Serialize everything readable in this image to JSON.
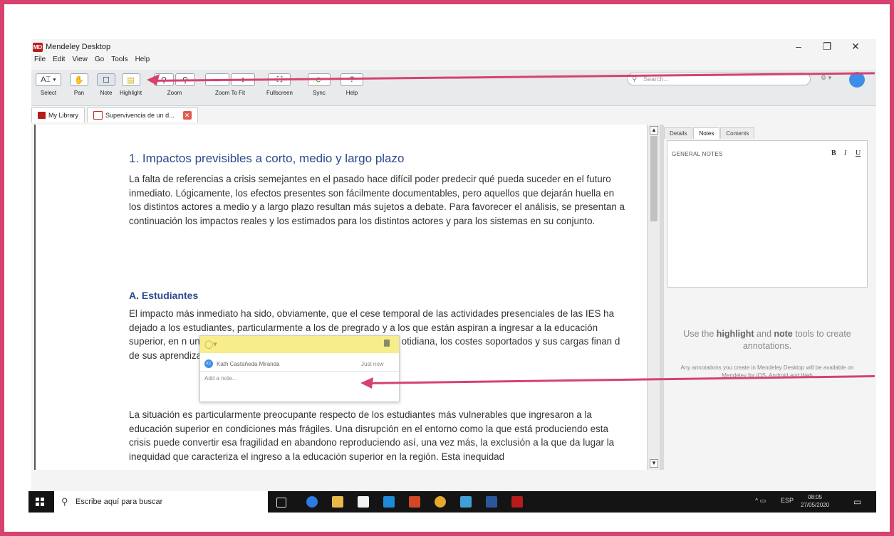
{
  "window": {
    "title": "Mendeley Desktop",
    "logo": "MD",
    "minimize": "–",
    "maximize": "❐",
    "close": "✕"
  },
  "menu": [
    "File",
    "Edit",
    "View",
    "Go",
    "Tools",
    "Help"
  ],
  "toolbar": {
    "select": "Select",
    "pan": "Pan",
    "note": "Note",
    "highlight": "Highlight",
    "zoom": "Zoom",
    "zoom_to_fit": "Zoom To Fit",
    "fullscreen": "Fullscreen",
    "sync": "Sync",
    "help": "Help",
    "search_placeholder": "Search..."
  },
  "tabs": {
    "library": "My Library",
    "document": "Supervivencia de un d..."
  },
  "document": {
    "heading": "1. Impactos previsibles a corto, medio y largo plazo",
    "para1": "La falta de referencias a crisis semejantes en el pasado hace difícil poder predecir qué pueda suceder en el futuro inmediato. Lógicamente, los efectos presentes son fácilmente documentables, pero aquellos que dejarán huella en los distintos actores a medio y a largo plazo resultan más sujetos a debate. Para favorecer el análisis, se presentan a continuación los impactos reales y los estimados para los distintos actores y para los sistemas en su conjunto.",
    "subheading": "A. Estudiantes",
    "para2": "El impacto más inmediato ha sido, obviamente, que el cese temporal de las actividades presenciales de las IES ha dejado a los estudiantes, particularmente a los de pregrado y a los que están aspiran a ingresar a la educación superior, en n una idea clara de cuánto tiempo vaya a durar con otidiana, los costes soportados y sus cargas finan d de sus aprendizajes.",
    "para3": "La situación es particularmente preocupante respecto de los estudiantes más vulnerables que ingresaron a la educación superior en condiciones más frágiles. Una disrupción en el entorno como la que está produciendo esta crisis puede convertir esa fragilidad en abandono reproduciendo así, una vez más, la exclusión a la que da lugar la inequidad que caracteriza el ingreso a la educación superior en la región. Esta inequidad"
  },
  "note_popup": {
    "user": "Kath Castañeda Miranda",
    "initials": "KC",
    "time": "Just now",
    "placeholder": "Add a note..."
  },
  "right_panel": {
    "tabs": [
      "Details",
      "Notes",
      "Contents"
    ],
    "general_notes": "GENERAL NOTES",
    "bold": "B",
    "italic": "I",
    "underline": "U",
    "hint_pre": "Use the ",
    "hint_highlight": "highlight",
    "hint_mid": " and ",
    "hint_note": "note",
    "hint_post": " tools to create annotations.",
    "hint_small": "Any annotations you create in Mendeley Desktop will be available on Mendeley for iOS, Android and Web"
  },
  "taskbar": {
    "search": "Escribe aquí para buscar",
    "lang": "ESP",
    "time": "08:05",
    "date": "27/05/2020"
  },
  "colors": {
    "accent": "#d6426e",
    "heading": "#2c4a8c",
    "note_yellow": "#f7ed8a"
  }
}
